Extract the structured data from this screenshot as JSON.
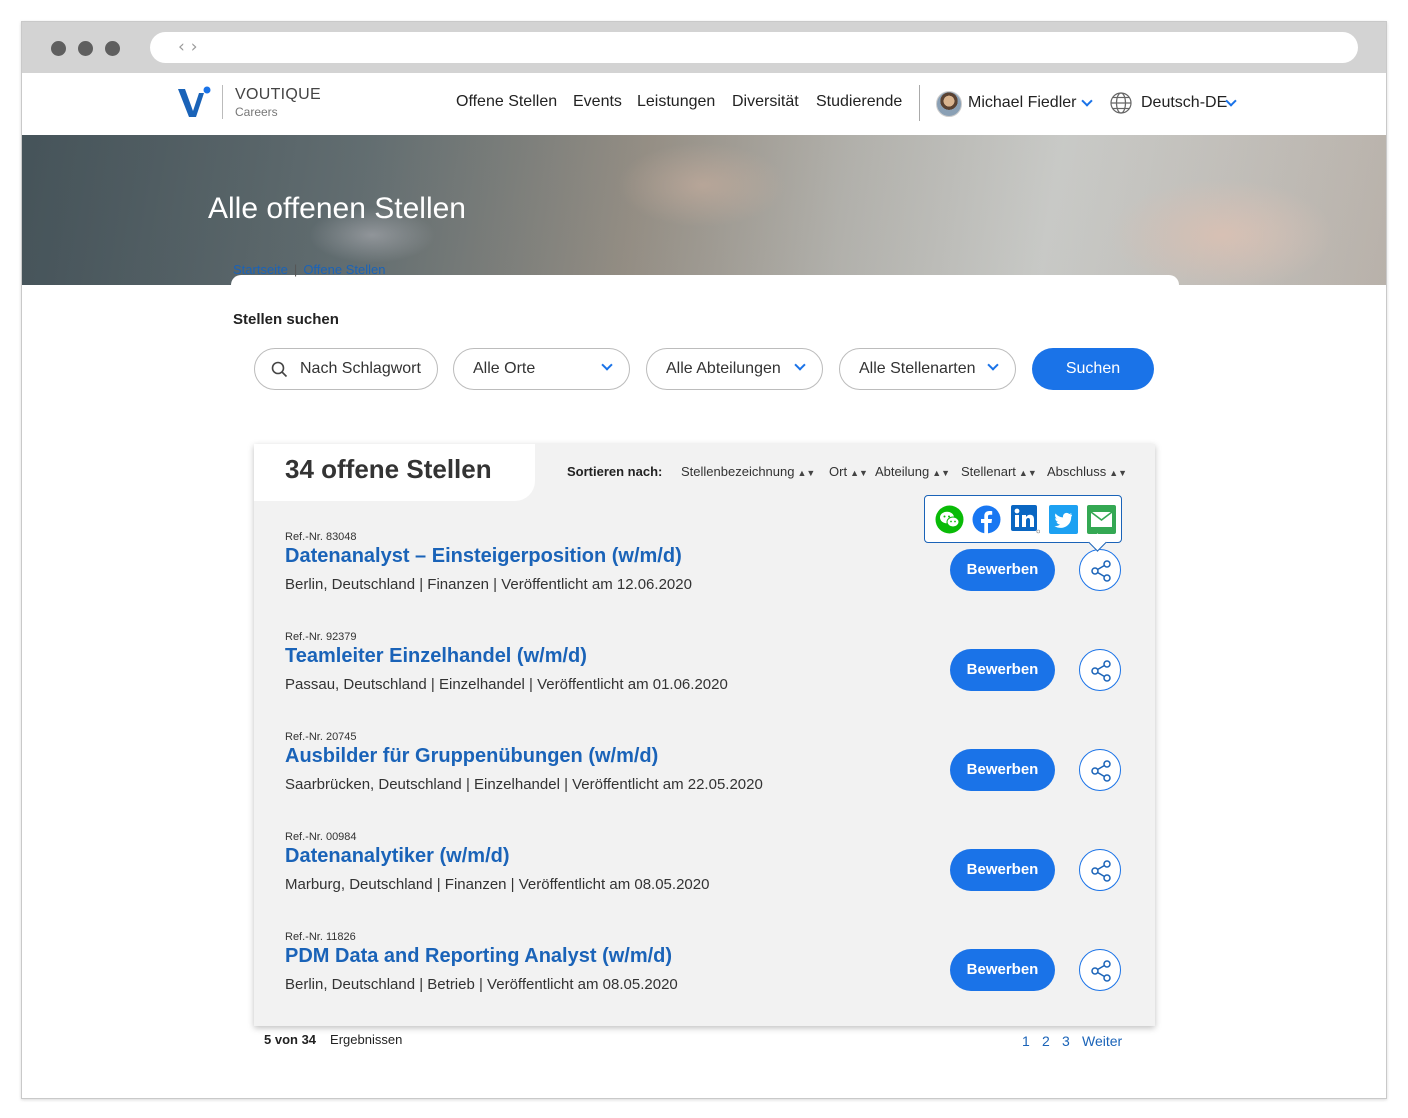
{
  "nav": {
    "brand": "VOUTIQUE",
    "brand_sub": "Careers",
    "items": [
      "Offene Stellen",
      "Events",
      "Leistungen",
      "Diversität",
      "Studierende"
    ],
    "user_name": "Michael Fiedler",
    "language": "Deutsch-DE"
  },
  "hero": {
    "title": "Alle offenen Stellen"
  },
  "breadcrumb": [
    "Startseite",
    "Offene Stellen"
  ],
  "search": {
    "label": "Stellen suchen",
    "keyword_placeholder": "Nach Schlagwort",
    "location": "Alle Orte",
    "department": "Alle Abteilungen",
    "job_type": "Alle Stellenarten",
    "button": "Suchen"
  },
  "results": {
    "title": "34 offene Stellen",
    "sort_label": "Sortieren nach:",
    "sort_options": [
      "Stellenbezeichnung",
      "Ort",
      "Abteilung",
      "Stellenart",
      "Abschluss"
    ],
    "apply_label": "Bewerben",
    "share_targets": [
      "wechat-icon",
      "facebook-icon",
      "linkedin-icon",
      "twitter-icon",
      "email-icon"
    ],
    "jobs": [
      {
        "ref": "Ref.-Nr. 83048",
        "title": "Datenanalyst – Einsteigerposition (w/m/d)",
        "meta": "Berlin, Deutschland |  Finanzen  |  Veröffentlicht am 12.06.2020"
      },
      {
        "ref": "Ref.-Nr. 92379",
        "title": "Teamleiter Einzelhandel (w/m/d)",
        "meta": "Passau, Deutschland |  Einzelhandel  |  Veröffentlicht am 01.06.2020"
      },
      {
        "ref": "Ref.-Nr. 20745",
        "title": "Ausbilder für Gruppenübungen (w/m/d)",
        "meta": "Saarbrücken, Deutschland |  Einzelhandel  |  Veröffentlicht am 22.05.2020"
      },
      {
        "ref": "Ref.-Nr. 00984",
        "title": "Datenanalytiker (w/m/d)",
        "meta": "Marburg, Deutschland |  Finanzen  |  Veröffentlicht am 08.05.2020"
      },
      {
        "ref": "Ref.-Nr. 11826",
        "title": "PDM Data and Reporting Analyst (w/m/d)",
        "meta": "Berlin, Deutschland |  Betrieb  |  Veröffentlicht am 08.05.2020"
      }
    ]
  },
  "footer": {
    "count_bold": "5 von 34",
    "count_text": "Ergebnissen",
    "pages": [
      "1",
      "2",
      "3"
    ],
    "next": "Weiter"
  },
  "colors": {
    "accent": "#1a73e8",
    "link": "#1a63b8"
  }
}
